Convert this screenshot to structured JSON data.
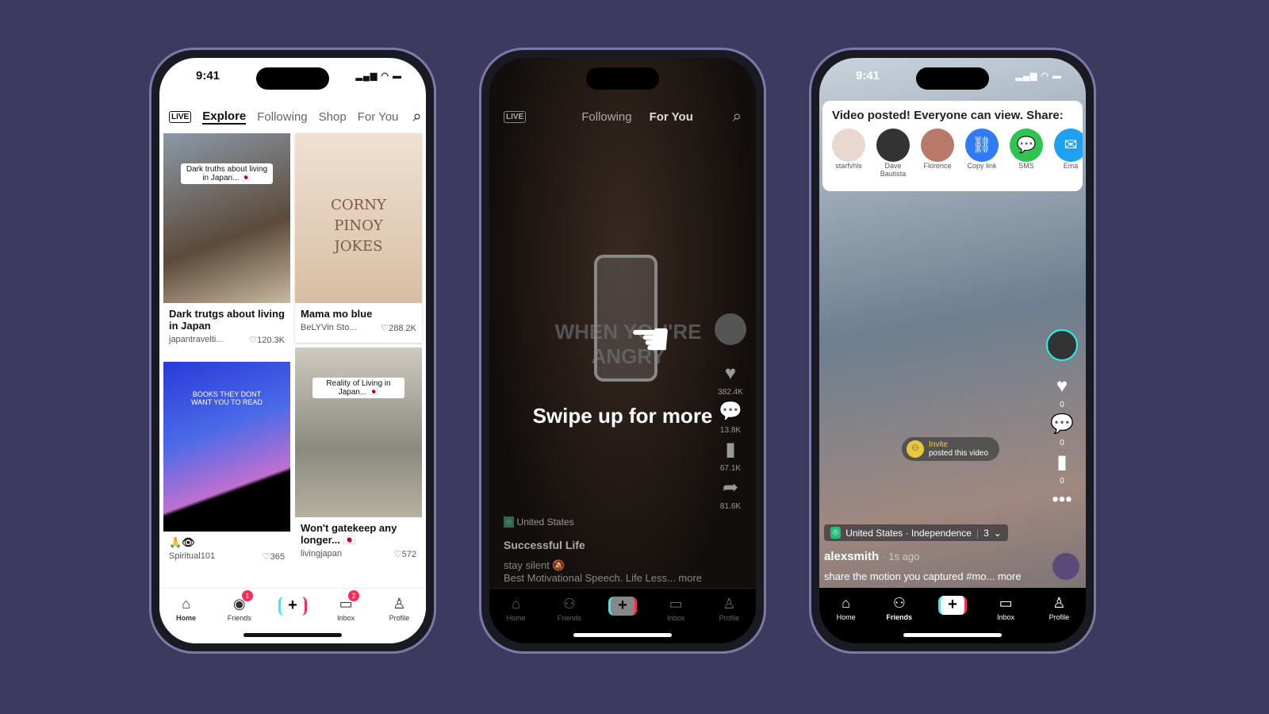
{
  "phone1": {
    "status": {
      "time": "9:41"
    },
    "nav": {
      "live": "LIVE",
      "tabs": [
        "Explore",
        "Following",
        "Shop",
        "For You"
      ],
      "active": "Explore"
    },
    "cards": [
      {
        "overlay": "Dark truths about living in Japan... 🇯🇵",
        "title": "Dark trutgs about living in Japan",
        "author": "japantravelti...",
        "likes": "120.3K"
      },
      {
        "overlay": "CORNY PINOY JOKES",
        "title": "Mama mo blue",
        "author": "BeLYVin Sto...",
        "likes": "288.2K"
      },
      {
        "overlay": "BOOKS THEY DONT WANT YOU TO READ",
        "title": "🙏👁",
        "author": "Spiritual101",
        "likes": "365"
      },
      {
        "overlay": "Reality of Living in Japan... 🇯🇵",
        "title": "Won't gatekeep any longer... 🇯🇵",
        "author": "livingjapan",
        "likes": "572"
      }
    ],
    "tabbar": [
      {
        "label": "Home"
      },
      {
        "label": "Friends",
        "badge": "1"
      },
      {
        "label": ""
      },
      {
        "label": "Inbox",
        "badge": "2"
      },
      {
        "label": "Profile"
      }
    ]
  },
  "phone2": {
    "nav": {
      "live": "LIVE",
      "tabs": [
        "Following",
        "For You"
      ],
      "active": "For You"
    },
    "video_text": "WHEN YOU'RE ANGRY",
    "swipe_hint": "Swipe up for more",
    "actions": {
      "likes": "382.4K",
      "comments": "13.8K",
      "saves": "67.1K",
      "shares": "81.6K"
    },
    "location": "United States",
    "title": "Successful Life",
    "caption1": "stay silent 🔕",
    "caption2": "Best Motivational Speech. Life Less... more",
    "tabbar": [
      {
        "label": "Home"
      },
      {
        "label": "Friends"
      },
      {
        "label": ""
      },
      {
        "label": "Inbox"
      },
      {
        "label": "Profile"
      }
    ]
  },
  "phone3": {
    "status": {
      "time": "9:41"
    },
    "share": {
      "title": "Video posted! Everyone can view. Share:",
      "targets": [
        {
          "label": "starfvhls"
        },
        {
          "label": "Dave Bautista"
        },
        {
          "label": "Florence"
        },
        {
          "label": "Copy link"
        },
        {
          "label": "SMS"
        },
        {
          "label": "Ema"
        }
      ]
    },
    "invite": {
      "label": "Invite",
      "sub": "posted this video"
    },
    "actions": {
      "likes": "0",
      "comments": "0",
      "saves": "0"
    },
    "location": "United States · Independence",
    "location_count": "3",
    "user": "alexsmith",
    "time_ago": "· 1s ago",
    "caption": "share the motion you captured #mo... more",
    "tabbar": [
      {
        "label": "Home"
      },
      {
        "label": "Friends"
      },
      {
        "label": ""
      },
      {
        "label": "Inbox"
      },
      {
        "label": "Profile"
      }
    ],
    "colors": {
      "copy_link": "#2f7bf5",
      "sms": "#2dc44f",
      "mail": "#1ea1f2"
    }
  }
}
